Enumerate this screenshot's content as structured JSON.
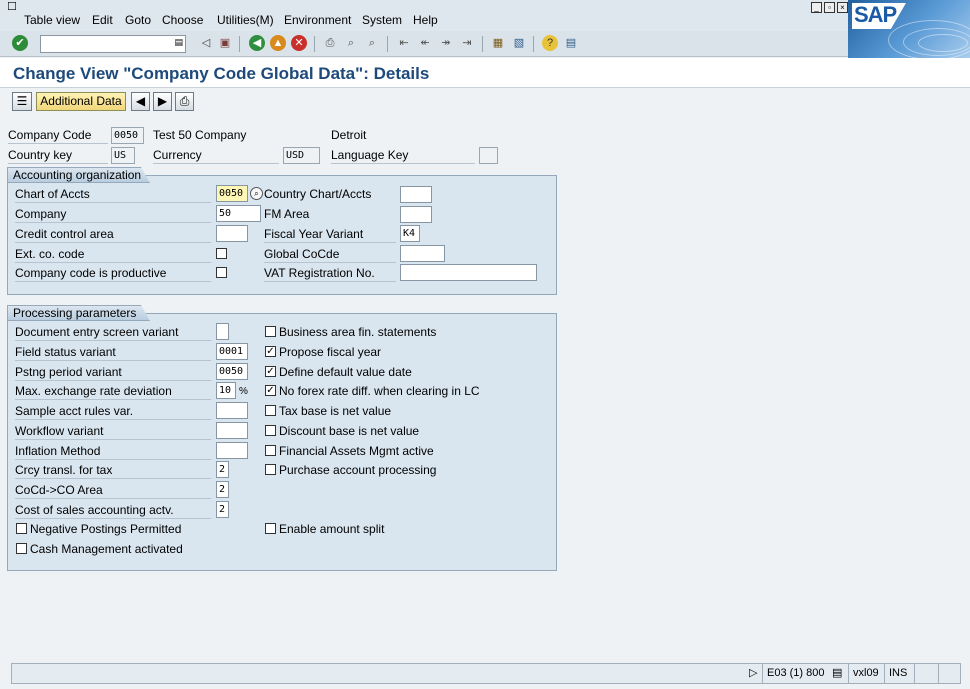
{
  "menu": {
    "items": [
      "Table view",
      "Edit",
      "Goto",
      "Choose",
      "Utilities(M)",
      "Environment",
      "System",
      "Help"
    ]
  },
  "brand": {
    "logo_text": "SAP"
  },
  "toolbar": {
    "command_field_value": "",
    "icons": [
      "enter-icon",
      "back-icon",
      "save-icon",
      "back-nav-icon",
      "exit-icon",
      "cancel-icon",
      "print-icon",
      "find-icon",
      "find-next-icon",
      "first-page-icon",
      "prev-page-icon",
      "next-page-icon",
      "last-page-icon",
      "create-session-icon",
      "shortcut-icon",
      "help-icon",
      "layout-icon"
    ]
  },
  "title": "Change View \"Company Code Global Data\": Details",
  "app_toolbar": {
    "additional_data_label": "Additional Data"
  },
  "header": {
    "company_code_label": "Company Code",
    "company_code_value": "0050",
    "company_name": "Test 50 Company",
    "city": "Detroit",
    "country_key_label": "Country key",
    "country_key_value": "US",
    "currency_label": "Currency",
    "currency_value": "USD",
    "language_key_label": "Language Key",
    "language_key_value": ""
  },
  "accounting_org": {
    "title": "Accounting organization",
    "chart_of_accts_label": "Chart of Accts",
    "chart_of_accts_value": "0050",
    "company_label": "Company",
    "company_value": "50",
    "credit_control_label": "Credit control area",
    "credit_control_value": "",
    "ext_co_code_label": "Ext. co. code",
    "productive_label": "Company code is productive",
    "country_chart_label": "Country Chart/Accts",
    "country_chart_value": "",
    "fm_area_label": "FM Area",
    "fm_area_value": "",
    "fiscal_year_variant_label": "Fiscal Year Variant",
    "fiscal_year_variant_value": "K4",
    "global_cocde_label": "Global CoCde",
    "global_cocde_value": "",
    "vat_label": "VAT Registration No.",
    "vat_value": ""
  },
  "processing": {
    "title": "Processing parameters",
    "doc_entry_label": "Document entry screen variant",
    "doc_entry_value": "",
    "field_status_label": "Field status variant",
    "field_status_value": "0001",
    "posting_period_label": "Pstng period variant",
    "posting_period_value": "0050",
    "max_exch_label": "Max. exchange rate deviation",
    "max_exch_value": "10",
    "max_exch_unit": "%",
    "sample_acct_label": "Sample acct rules var.",
    "sample_acct_value": "",
    "workflow_label": "Workflow variant",
    "workflow_value": "",
    "inflation_label": "Inflation Method",
    "inflation_value": "",
    "crcy_transl_label": "Crcy transl. for tax",
    "crcy_transl_value": "2",
    "cocd_co_label": "CoCd->CO Area",
    "cocd_co_value": "2",
    "cost_of_sales_label": "Cost of sales accounting actv.",
    "cost_of_sales_value": "2",
    "negative_postings_label": "Negative Postings Permitted",
    "cash_mgmt_label": "Cash Management activated",
    "business_area_label": "Business area fin. statements",
    "propose_fy_label": "Propose fiscal year",
    "default_value_date_label": "Define default value date",
    "no_forex_label": "No forex rate diff. when clearing in LC",
    "tax_base_label": "Tax base is net value",
    "discount_base_label": "Discount base is net value",
    "fin_assets_label": "Financial Assets Mgmt active",
    "purchase_acct_label": "Purchase account processing",
    "amount_split_label": "Enable amount split",
    "checks": {
      "negative_postings": "",
      "cash_mgmt": "",
      "business_area": "",
      "propose_fy": "✓",
      "default_value_date": "✓",
      "no_forex": "✓",
      "tax_base": "",
      "discount_base": "",
      "fin_assets": "",
      "purchase_acct": "",
      "amount_split": "",
      "ext_co_code": "",
      "productive": ""
    }
  },
  "status_bar": {
    "system": "E03 (1) 800",
    "server": "vxl09",
    "mode": "INS"
  }
}
